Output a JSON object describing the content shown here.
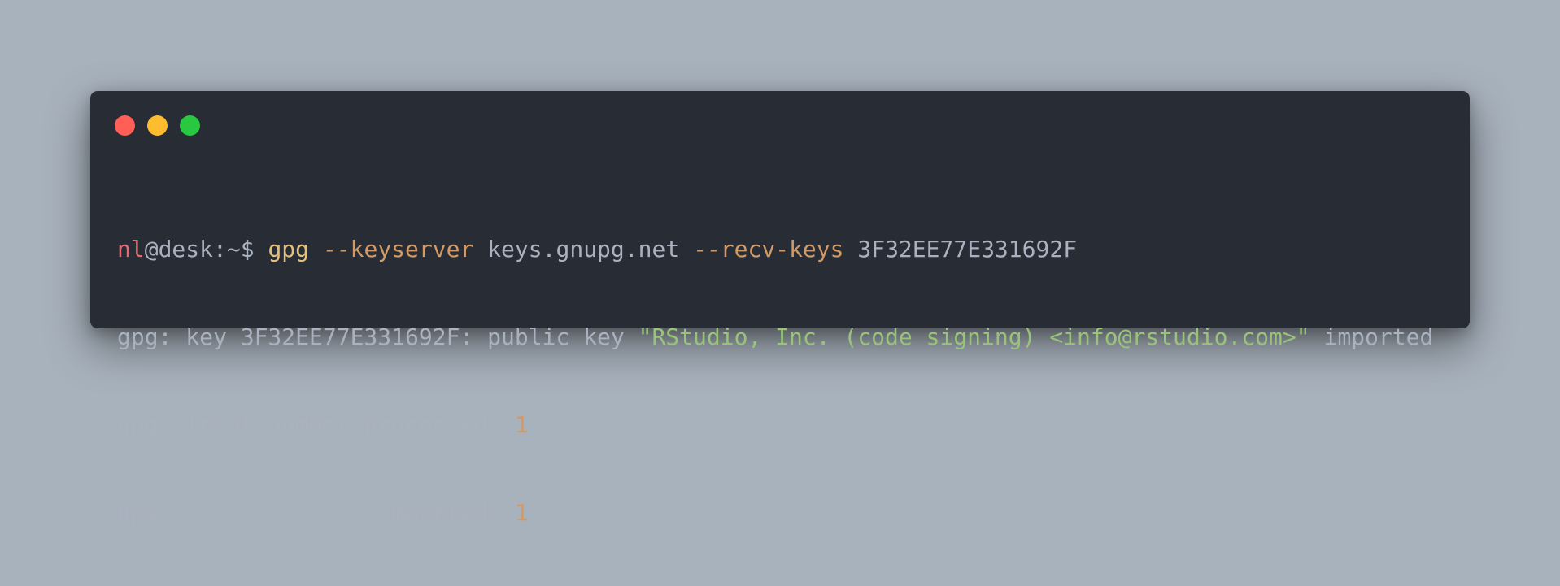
{
  "window": {
    "controls": {
      "close": "red-dot",
      "minimize": "yellow-dot",
      "maximize": "green-dot"
    }
  },
  "terminal": {
    "line1": {
      "user": "nl",
      "host": "@desk",
      "path": ":~",
      "prompt": "$ ",
      "command": "gpg",
      "flag1": "--keyserver",
      "arg1": "keys.gnupg.net",
      "flag2": "--recv-keys",
      "arg2": "3F32EE77E331692F"
    },
    "line2": {
      "prefix": "gpg: key 3F32EE77E331692F: public key ",
      "quoted": "\"RStudio, Inc. (code signing) <info@rstudio.com>\"",
      "suffix": " imported"
    },
    "line3": {
      "label": "gpg: Total number processed: ",
      "value": "1"
    },
    "line4": {
      "label": "gpg:               imported: ",
      "value": "1"
    }
  },
  "colors": {
    "background": "#a8b2bd",
    "window": "#282c35",
    "user": "#e06c75",
    "text": "#abb2bf",
    "command": "#e5c07b",
    "flag": "#d19a66",
    "string": "#98c379",
    "number": "#d19a66"
  }
}
